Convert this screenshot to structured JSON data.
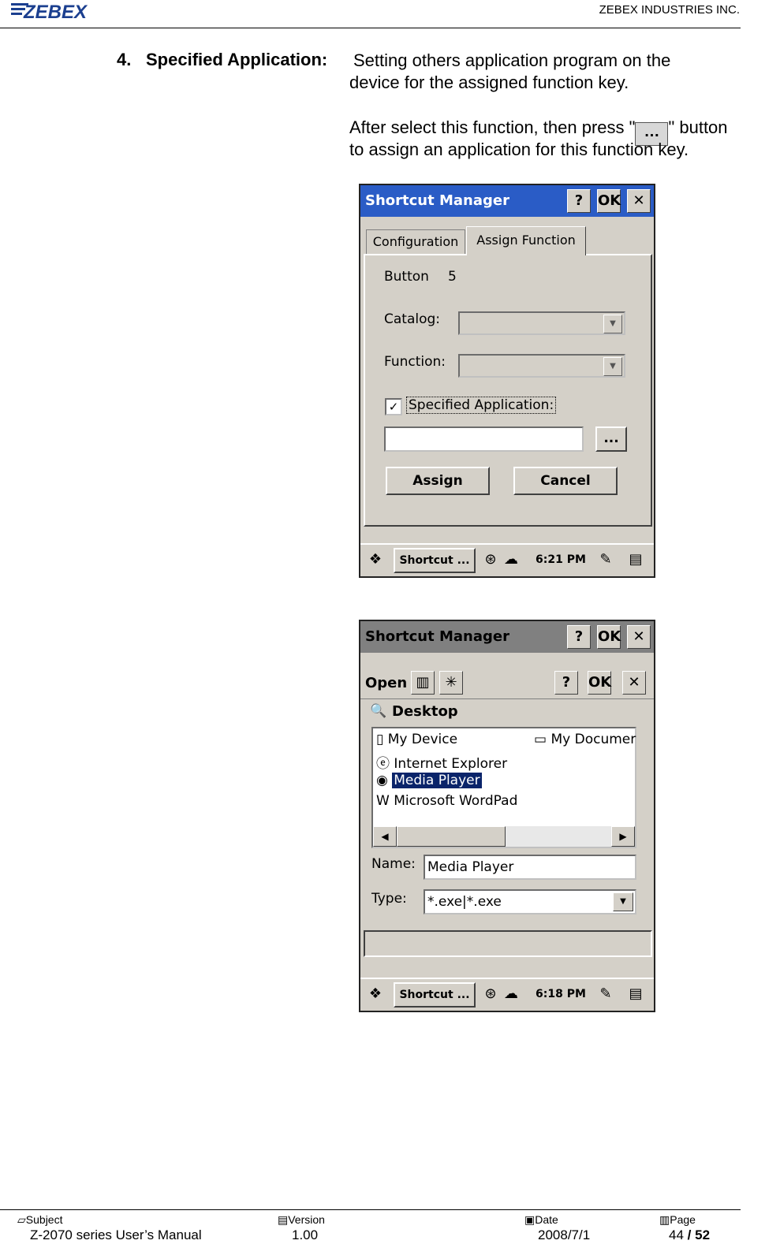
{
  "header": {
    "logo": "ZEBEX",
    "company": "ZEBEX INDUSTRIES INC."
  },
  "section": {
    "number": "4.",
    "heading": "Specified Application:",
    "line1": "Setting others application program on the",
    "line2": "device for the assigned function key.",
    "line3a": "After select this function, then press \"",
    "button_glyph": "…",
    "line3b": "\" button",
    "line4": "to assign an application for this function key."
  },
  "screen1": {
    "title": "Shortcut Manager",
    "help": "?",
    "ok": "OK",
    "close": "✕",
    "tabs": [
      "Configuration",
      "Assign Function"
    ],
    "button_label": "Button",
    "button_value": "5",
    "catalog_label": "Catalog:",
    "function_label": "Function:",
    "specified_label": "Specified Application:",
    "browse_label": "...",
    "assign_label": "Assign",
    "cancel_label": "Cancel",
    "taskbar_app": "Shortcut ...",
    "clock": "6:21 PM"
  },
  "screen2": {
    "title": "Shortcut Manager",
    "help": "?",
    "ok": "OK",
    "close": "✕",
    "dialog_title": "Open",
    "location": "Desktop",
    "files": [
      "My Device",
      "Internet Explorer",
      "Media Player",
      "Microsoft WordPad"
    ],
    "files_col2": [
      "My Documer"
    ],
    "name_label": "Name:",
    "name_value": "Media Player",
    "type_label": "Type:",
    "type_value": "*.exe|*.exe",
    "taskbar_app": "Shortcut ...",
    "clock": "6:18 PM"
  },
  "footer": {
    "subject_label": "Subject",
    "subject": "Z-2070 series User’s Manual",
    "version_label": "Version",
    "version": "1.00",
    "date_label": "Date",
    "date": "2008/7/1",
    "page_label": "Page",
    "page": "44",
    "page_sep": "/",
    "page_total": "52"
  },
  "colors": {
    "titlebar": "#2a5cc6",
    "titlebar_inactive": "#808080",
    "selection": "#0a246a"
  }
}
